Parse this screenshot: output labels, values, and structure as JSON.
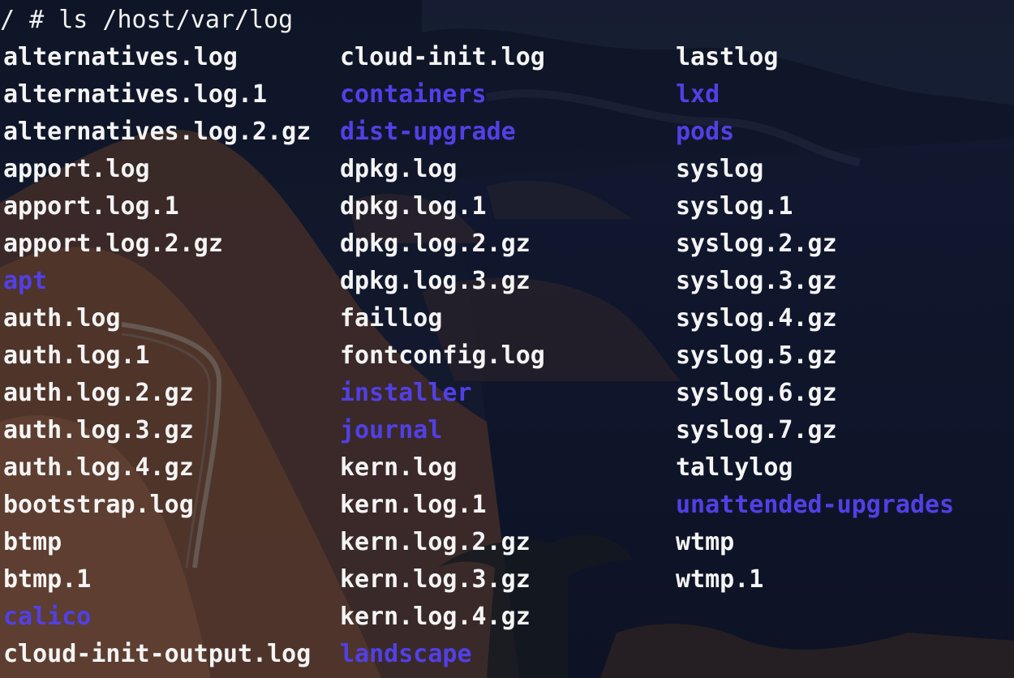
{
  "terminal": {
    "prompt": "/ # ls /host/var/log",
    "colors": {
      "file": "#f4f4f4",
      "directory": "#5140e6"
    },
    "columns": [
      [
        {
          "name": "alternatives.log",
          "type": "file"
        },
        {
          "name": "alternatives.log.1",
          "type": "file"
        },
        {
          "name": "alternatives.log.2.gz",
          "type": "file"
        },
        {
          "name": "apport.log",
          "type": "file"
        },
        {
          "name": "apport.log.1",
          "type": "file"
        },
        {
          "name": "apport.log.2.gz",
          "type": "file"
        },
        {
          "name": "apt",
          "type": "directory"
        },
        {
          "name": "auth.log",
          "type": "file"
        },
        {
          "name": "auth.log.1",
          "type": "file"
        },
        {
          "name": "auth.log.2.gz",
          "type": "file"
        },
        {
          "name": "auth.log.3.gz",
          "type": "file"
        },
        {
          "name": "auth.log.4.gz",
          "type": "file"
        },
        {
          "name": "bootstrap.log",
          "type": "file"
        },
        {
          "name": "btmp",
          "type": "file"
        },
        {
          "name": "btmp.1",
          "type": "file"
        },
        {
          "name": "calico",
          "type": "directory"
        },
        {
          "name": "cloud-init-output.log",
          "type": "file"
        }
      ],
      [
        {
          "name": "cloud-init.log",
          "type": "file"
        },
        {
          "name": "containers",
          "type": "directory"
        },
        {
          "name": "dist-upgrade",
          "type": "directory"
        },
        {
          "name": "dpkg.log",
          "type": "file"
        },
        {
          "name": "dpkg.log.1",
          "type": "file"
        },
        {
          "name": "dpkg.log.2.gz",
          "type": "file"
        },
        {
          "name": "dpkg.log.3.gz",
          "type": "file"
        },
        {
          "name": "faillog",
          "type": "file"
        },
        {
          "name": "fontconfig.log",
          "type": "file"
        },
        {
          "name": "installer",
          "type": "directory"
        },
        {
          "name": "journal",
          "type": "directory"
        },
        {
          "name": "kern.log",
          "type": "file"
        },
        {
          "name": "kern.log.1",
          "type": "file"
        },
        {
          "name": "kern.log.2.gz",
          "type": "file"
        },
        {
          "name": "kern.log.3.gz",
          "type": "file"
        },
        {
          "name": "kern.log.4.gz",
          "type": "file"
        },
        {
          "name": "landscape",
          "type": "directory"
        }
      ],
      [
        {
          "name": "lastlog",
          "type": "file"
        },
        {
          "name": "lxd",
          "type": "directory"
        },
        {
          "name": "pods",
          "type": "directory"
        },
        {
          "name": "syslog",
          "type": "file"
        },
        {
          "name": "syslog.1",
          "type": "file"
        },
        {
          "name": "syslog.2.gz",
          "type": "file"
        },
        {
          "name": "syslog.3.gz",
          "type": "file"
        },
        {
          "name": "syslog.4.gz",
          "type": "file"
        },
        {
          "name": "syslog.5.gz",
          "type": "file"
        },
        {
          "name": "syslog.6.gz",
          "type": "file"
        },
        {
          "name": "syslog.7.gz",
          "type": "file"
        },
        {
          "name": "tallylog",
          "type": "file"
        },
        {
          "name": "unattended-upgrades",
          "type": "directory"
        },
        {
          "name": "wtmp",
          "type": "file"
        },
        {
          "name": "wtmp.1",
          "type": "file"
        }
      ]
    ]
  }
}
